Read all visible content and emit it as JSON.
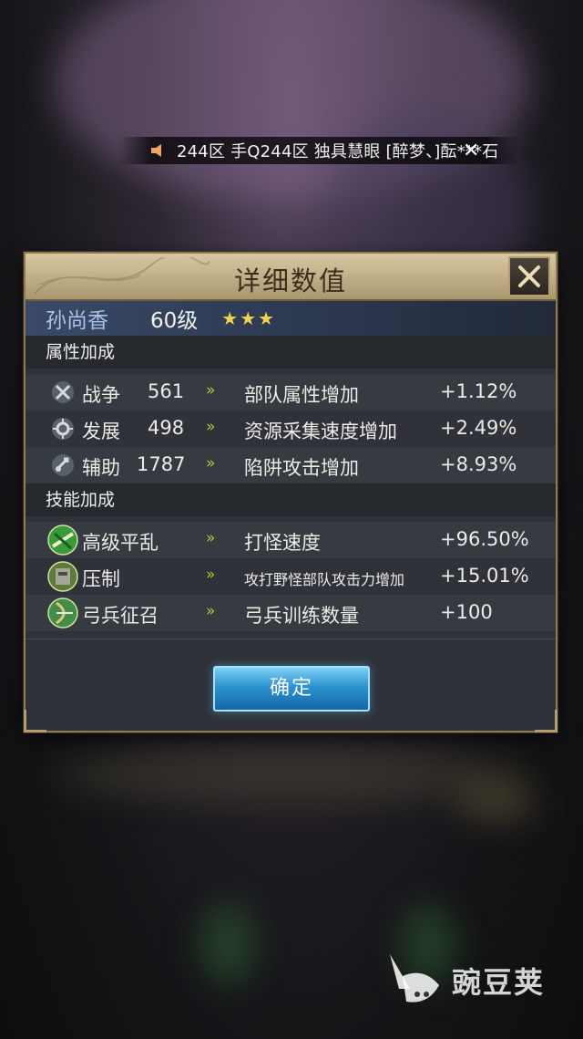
{
  "broadcast": {
    "message": "244区  手Q244区  独具慧眼  [醉梦、]酝***石",
    "close_icon": "close-icon"
  },
  "dialog": {
    "title": "详细数值",
    "hero": {
      "name": "孙尚香",
      "level": "60级",
      "star_count": 3,
      "star": "★"
    },
    "attribute_section": {
      "label": "属性加成",
      "rows": [
        {
          "icon": "swords-icon",
          "name": "战争",
          "value": "561",
          "arrow": "»",
          "effect": "部队属性增加",
          "bonus": "+1.12%"
        },
        {
          "icon": "development-icon",
          "name": "发展",
          "value": "498",
          "arrow": "»",
          "effect": "资源采集速度增加",
          "bonus": "+2.49%"
        },
        {
          "icon": "assist-icon",
          "name": "辅助",
          "value": "1787",
          "arrow": "»",
          "effect": "陷阱攻击增加",
          "bonus": "+8.93%"
        }
      ]
    },
    "skill_section": {
      "label": "技能加成",
      "rows": [
        {
          "icon": "skill-pacify-icon",
          "name": "高级平乱",
          "arrow": "»",
          "effect": "打怪速度",
          "bonus": "+96.50%"
        },
        {
          "icon": "skill-suppress-icon",
          "name": "压制",
          "arrow": "»",
          "effect": "攻打野怪部队攻击力增加",
          "bonus": "+15.01%"
        },
        {
          "icon": "skill-archer-icon",
          "name": "弓兵征召",
          "arrow": "»",
          "effect": "弓兵训练数量",
          "bonus": "+100"
        }
      ]
    },
    "confirm_label": "确定"
  },
  "watermark": {
    "text": "豌豆荚",
    "logo_icon": "wandoujia-logo-icon"
  },
  "colors": {
    "accent_green": "#a5d13a",
    "hero_name": "#a9c3ec",
    "star": "#f4d24a",
    "button": "#2b93d0",
    "frame_gold": "#8d7a52"
  }
}
